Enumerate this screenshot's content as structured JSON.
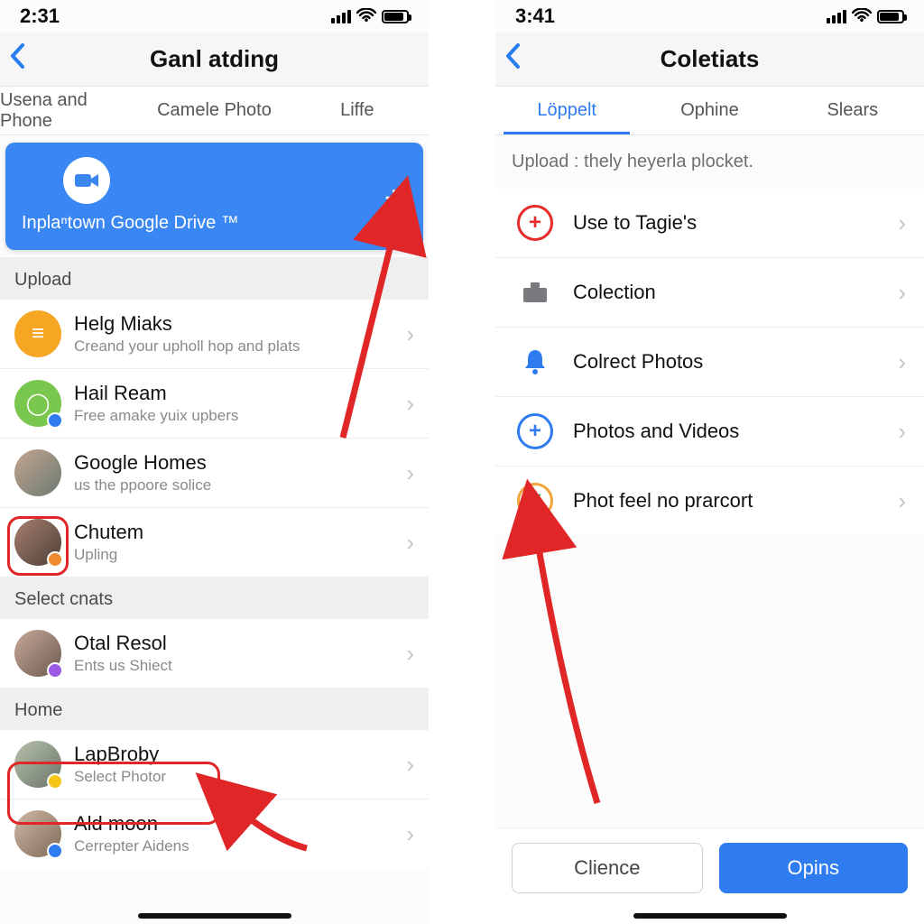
{
  "left": {
    "status_time": "2:31",
    "nav_title": "Ganl atding",
    "tabs": [
      "Usena and Phone",
      "Camele Photo",
      "Liffe"
    ],
    "banner": {
      "label": "Inplaⁿtown Google Drive ™",
      "plus_icon": "+"
    },
    "sections": {
      "upload": {
        "header": "Upload",
        "rows": [
          {
            "title": "Helg Miaks",
            "subtitle": "Creand your upholl hop and plats"
          },
          {
            "title": "Hail Ream",
            "subtitle": "Free amake yuix upbers"
          },
          {
            "title": "Google Homes",
            "subtitle": "us the ppoore solice"
          },
          {
            "title": "Chutem",
            "subtitle": "Upling"
          }
        ]
      },
      "select": {
        "header": "Select cnats",
        "rows": [
          {
            "title": "Otal Resol",
            "subtitle": "Ents us Shiect"
          }
        ]
      },
      "home": {
        "header": "Home",
        "rows": [
          {
            "title": "LapBroby",
            "subtitle": "Select Photor"
          },
          {
            "title": "Ald moon",
            "subtitle": "Cerrepter Aidens"
          }
        ]
      }
    }
  },
  "right": {
    "status_time": "3:41",
    "nav_title": "Coletiats",
    "tabs": [
      "Löppelt",
      "Ophine",
      "Slears"
    ],
    "hint": "Upload : thely heyerla plocket.",
    "rows": [
      {
        "icon": "plus-red",
        "title": "Use to Tagie's"
      },
      {
        "icon": "briefcase",
        "title": "Colection"
      },
      {
        "icon": "bell",
        "title": "Colrect Photos"
      },
      {
        "icon": "plus-blue",
        "title": "Photos and Videos"
      },
      {
        "icon": "check-green",
        "title": "Phot feel no prarcort"
      }
    ],
    "buttons": {
      "secondary": "Clience",
      "primary": "Opins"
    }
  },
  "colors": {
    "accent": "#2f7cf0",
    "danger": "#e02626"
  }
}
